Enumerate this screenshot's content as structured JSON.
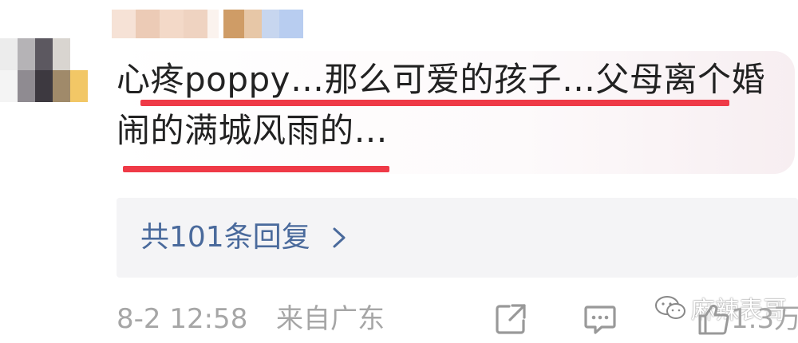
{
  "comment": {
    "line1": "心疼poppy…那么可爱的孩子…父母离个婚",
    "line2": "闹的满城风雨的…"
  },
  "replies": {
    "label": "共101条回复"
  },
  "meta": {
    "timestamp": "8-2 12:58",
    "location": "来自广东"
  },
  "actions": {
    "like_count": "1.3万"
  },
  "watermark": {
    "text": "麻辣表哥"
  },
  "colors": {
    "highlight_underline": "#ef3a47",
    "reply_link": "#4a6a9c",
    "meta_text": "#a6a6a6"
  },
  "icons": [
    "share-icon",
    "comment-icon",
    "like-icon",
    "chevron-right-icon"
  ]
}
